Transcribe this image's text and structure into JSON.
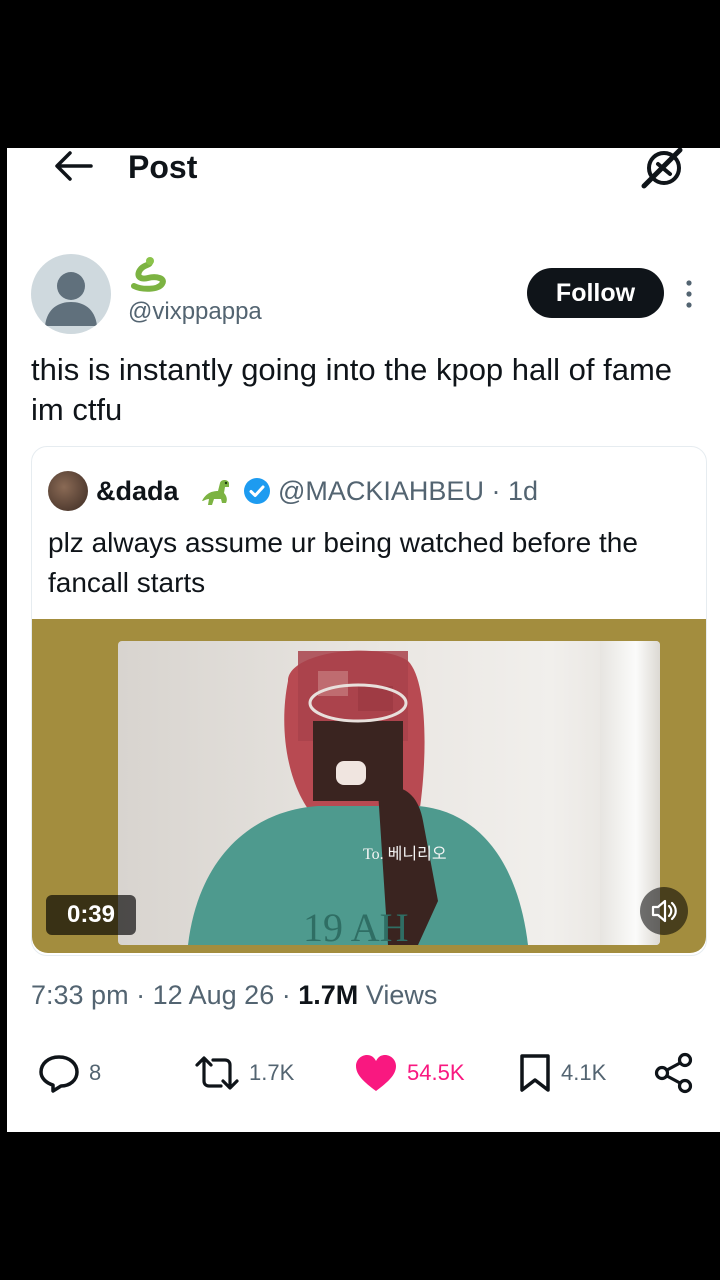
{
  "header": {
    "title": "Post",
    "back_icon": "arrow-left-icon",
    "grok_icon": "grok-icon"
  },
  "author": {
    "display_name_emoji": "🐍",
    "handle": "@vixppappa",
    "follow_label": "Follow"
  },
  "tweet": {
    "text": "this is instantly going into the kpop hall of fame im ctfu"
  },
  "quote": {
    "name": "&dada",
    "emoji": "🦖",
    "verified": true,
    "handle": "@MACKIAHBEU",
    "age": "· 1d",
    "text": "plz always assume ur being watched before the fancall starts",
    "video": {
      "duration": "0:39",
      "caption": "To. 베니리오",
      "shirt_text": "19 AH"
    }
  },
  "meta": {
    "time": "7:33 pm",
    "date": "12 Aug 26",
    "views_count": "1.7M",
    "views_label": "Views",
    "sep": "·"
  },
  "actions": {
    "replies": "8",
    "reposts": "1.7K",
    "likes": "54.5K",
    "bookmarks": "4.1K"
  },
  "colors": {
    "like": "#f91880",
    "verified": "#1d9bf0",
    "media_bg": "#a38d3e"
  }
}
